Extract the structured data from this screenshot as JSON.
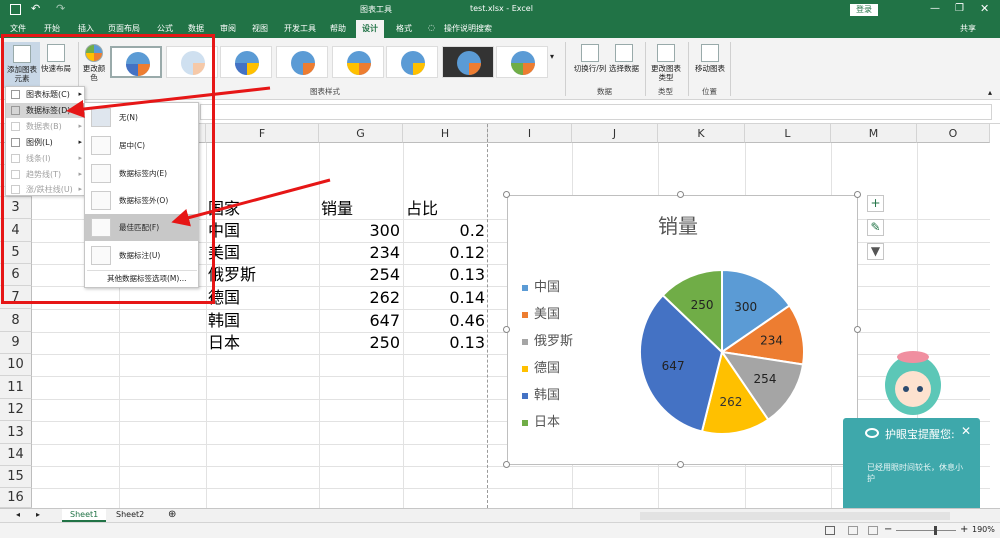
{
  "titlebar": {
    "title": "test.xlsx - Excel",
    "contextual_tab": "图表工具",
    "login_label": "登录",
    "share_label": "共享"
  },
  "tabs": [
    "文件",
    "开始",
    "插入",
    "页面布局",
    "公式",
    "数据",
    "审阅",
    "视图",
    "开发工具",
    "帮助",
    "设计",
    "格式"
  ],
  "tell_me": "操作说明搜索",
  "ribbon": {
    "add_chart_element": "添加图表元素",
    "quick_layout": "快速布局",
    "change_colors": "更改颜色",
    "chart_styles_group": "图表样式",
    "switch_row_col": "切换行/列",
    "select_data": "选择数据",
    "data_group": "数据",
    "change_chart_type": "更改图表类型",
    "type_group": "类型",
    "move_chart": "移动图表",
    "location_group": "位置"
  },
  "menu1": [
    {
      "label": "图表标题(C)",
      "disabled": false
    },
    {
      "label": "数据标签(D)",
      "disabled": false
    },
    {
      "label": "数据表(B)",
      "disabled": true
    },
    {
      "label": "图例(L)",
      "disabled": false
    },
    {
      "label": "线条(I)",
      "disabled": true
    },
    {
      "label": "趋势线(T)",
      "disabled": true
    },
    {
      "label": "涨/跌柱线(U)",
      "disabled": true
    }
  ],
  "menu2": [
    {
      "label": "无(N)"
    },
    {
      "label": "居中(C)"
    },
    {
      "label": "数据标签内(E)"
    },
    {
      "label": "数据标签外(O)"
    },
    {
      "label": "最佳匹配(F)"
    },
    {
      "label": "数据标注(U)"
    }
  ],
  "menu2_more": "其他数据标签选项(M)...",
  "columns": [
    "F",
    "G",
    "H",
    "I",
    "J",
    "K",
    "L",
    "M",
    "O"
  ],
  "rows": [
    "3",
    "4",
    "5",
    "6",
    "7",
    "8",
    "9",
    "10",
    "11",
    "12",
    "13",
    "14",
    "15",
    "16"
  ],
  "table": {
    "headers": [
      "国家",
      "销量",
      "占比"
    ],
    "rows": [
      [
        "中国",
        "300",
        "0.2"
      ],
      [
        "美国",
        "234",
        "0.12"
      ],
      [
        "俄罗斯",
        "254",
        "0.13"
      ],
      [
        "德国",
        "262",
        "0.14"
      ],
      [
        "韩国",
        "647",
        "0.46"
      ],
      [
        "日本",
        "250",
        "0.13"
      ]
    ]
  },
  "chart_data": {
    "type": "pie",
    "title": "销量",
    "categories": [
      "中国",
      "美国",
      "俄罗斯",
      "德国",
      "韩国",
      "日本"
    ],
    "values": [
      300,
      234,
      254,
      262,
      647,
      250
    ],
    "colors": [
      "#5b9bd5",
      "#ed7d31",
      "#a5a5a5",
      "#ffc000",
      "#4472c4",
      "#70ad47"
    ],
    "legend": "left"
  },
  "sheets": [
    "Sheet1",
    "Sheet2"
  ],
  "popup": {
    "title": "护眼宝提醒您:",
    "body": "已经用眼时间较长，休息小护"
  },
  "status": {
    "zoom": "190%"
  }
}
